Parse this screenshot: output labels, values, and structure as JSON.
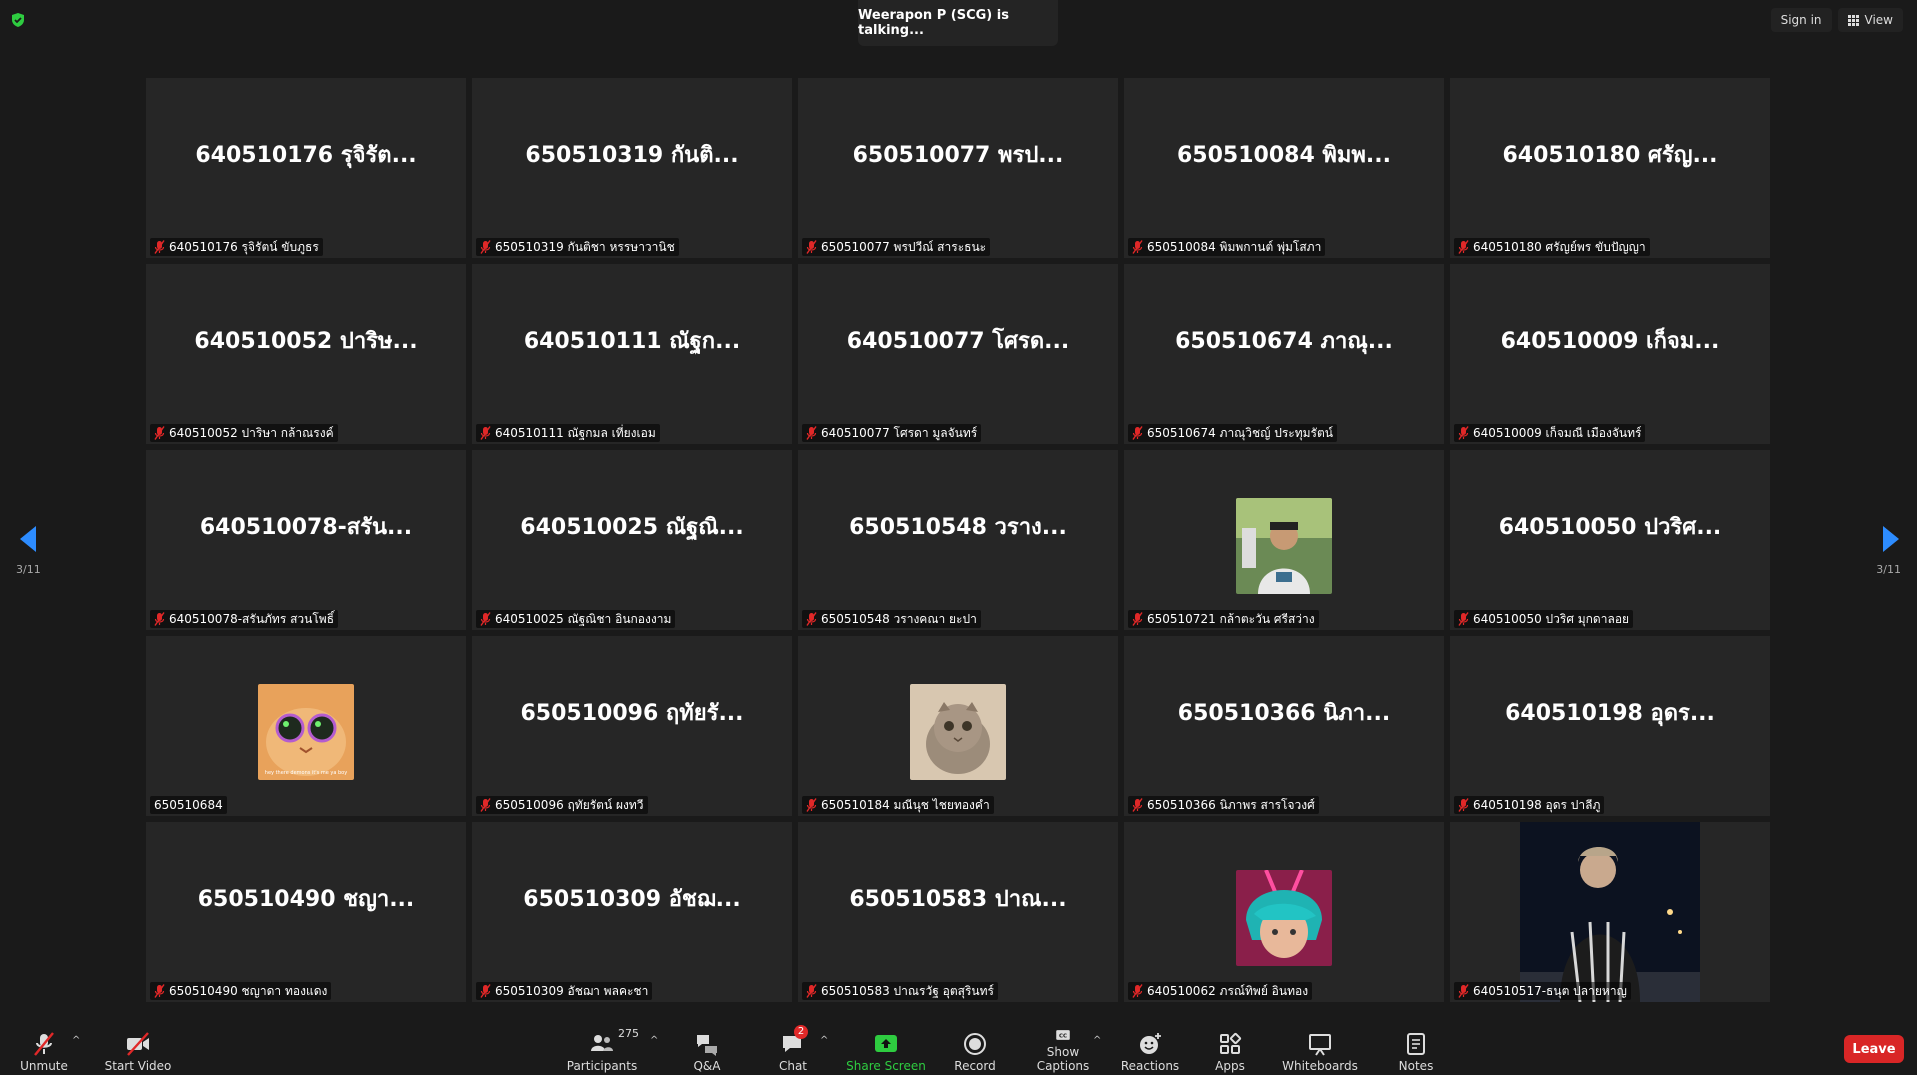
{
  "speaker_banner": "Weerapon P (SCG) is talking...",
  "top_right": {
    "sign_in": "Sign in",
    "view": "View"
  },
  "pagination": {
    "left": "3/11",
    "right": "3/11"
  },
  "tiles": [
    {
      "title": "640510176 รุจิรัต...",
      "label": "640510176 รุจิรัตน์ ขับภูธร",
      "muted": true
    },
    {
      "title": "650510319 กันติ...",
      "label": "650510319 กันติชา หรรษาวานิช",
      "muted": true
    },
    {
      "title": "650510077 พรป...",
      "label": "650510077 พรปวีณ์ สาระธนะ",
      "muted": true
    },
    {
      "title": "650510084 พิมพ...",
      "label": "650510084 พิมพกานต์ พุ่มโสภา",
      "muted": true
    },
    {
      "title": "640510180 ศรัญ...",
      "label": "640510180 ศรัญย์พร ขับปัญญา",
      "muted": true
    },
    {
      "title": "640510052 ปาริษ...",
      "label": "640510052 ปาริษา กล้าณรงค์",
      "muted": true
    },
    {
      "title": "640510111 ณัฐก...",
      "label": "640510111 ณัฐกมล   เที่ยงเอม",
      "muted": true
    },
    {
      "title": "640510077 โศรด...",
      "label": "640510077 โศรดา มูลจันทร์",
      "muted": true
    },
    {
      "title": "650510674 ภาณุ...",
      "label": "650510674 ภาณุวิชญ์ ประทุมรัตน์",
      "muted": true
    },
    {
      "title": "640510009 เก็จม...",
      "label": "640510009 เก็จมณี เมืองจันทร์",
      "muted": true
    },
    {
      "title": "640510078-สรัน...",
      "label": "640510078-สรันภัทร สวนโพธิ์",
      "muted": true
    },
    {
      "title": "640510025 ณัฐณิ...",
      "label": "640510025 ณัฐณิชา อินกองงาม",
      "muted": true
    },
    {
      "title": "650510548 วราง...",
      "label": "650510548 วรางคณา ยะปา",
      "muted": true
    },
    {
      "title": "",
      "label": "650510721 กล้าตะวัน ศรีสว่าง",
      "muted": true,
      "avatar": "person-photo"
    },
    {
      "title": "640510050 ปวริศ...",
      "label": "640510050 ปวริศ มุกดาลอย",
      "muted": true
    },
    {
      "title": "",
      "label": "650510684",
      "muted": false,
      "avatar": "cat-sunglasses",
      "avatar_caption": "hey there demons it's me ya boy"
    },
    {
      "title": "650510096 ฤทัยรั...",
      "label": "650510096 ฤทัยรัตน์ ผงทวี",
      "muted": true
    },
    {
      "title": "",
      "label": "650510184 มณีนุช ไชยทองคำ",
      "muted": true,
      "avatar": "kitten-photo"
    },
    {
      "title": "650510366 นิภา...",
      "label": "650510366 นิภาพร สารโจวงศ์",
      "muted": true
    },
    {
      "title": "640510198 อุดร...",
      "label": "640510198 อุดร ปาลีภู",
      "muted": true
    },
    {
      "title": "650510490 ชญา...",
      "label": "650510490 ชญาดา ทองแดง",
      "muted": true
    },
    {
      "title": "650510309 อัชฌ...",
      "label": "650510309 อัชฌา พลคะชา",
      "muted": true
    },
    {
      "title": "650510583 ปาณ...",
      "label": "650510583 ปาณรวัฐ อุตสุรินทร์",
      "muted": true
    },
    {
      "title": "",
      "label": "640510062 ภรณ์ทิพย์ อินทอง",
      "muted": true,
      "avatar": "anime-avatar"
    },
    {
      "title": "",
      "label": "640510517-ธนุต ปลายหาญ",
      "muted": true,
      "avatar": "night-portrait"
    }
  ],
  "toolbar": {
    "unmute": "Unmute",
    "start_video": "Start Video",
    "participants": "Participants",
    "participants_count": "275",
    "qa": "Q&A",
    "chat": "Chat",
    "chat_badge": "2",
    "share_screen": "Share Screen",
    "record": "Record",
    "show_captions": "Show Captions",
    "reactions": "Reactions",
    "apps": "Apps",
    "whiteboards": "Whiteboards",
    "notes": "Notes",
    "leave": "Leave"
  },
  "colors": {
    "accent_green": "#2ecc40",
    "leave_red": "#d92626",
    "arrow_blue": "#2d8cff",
    "mic_red": "#e02828"
  }
}
